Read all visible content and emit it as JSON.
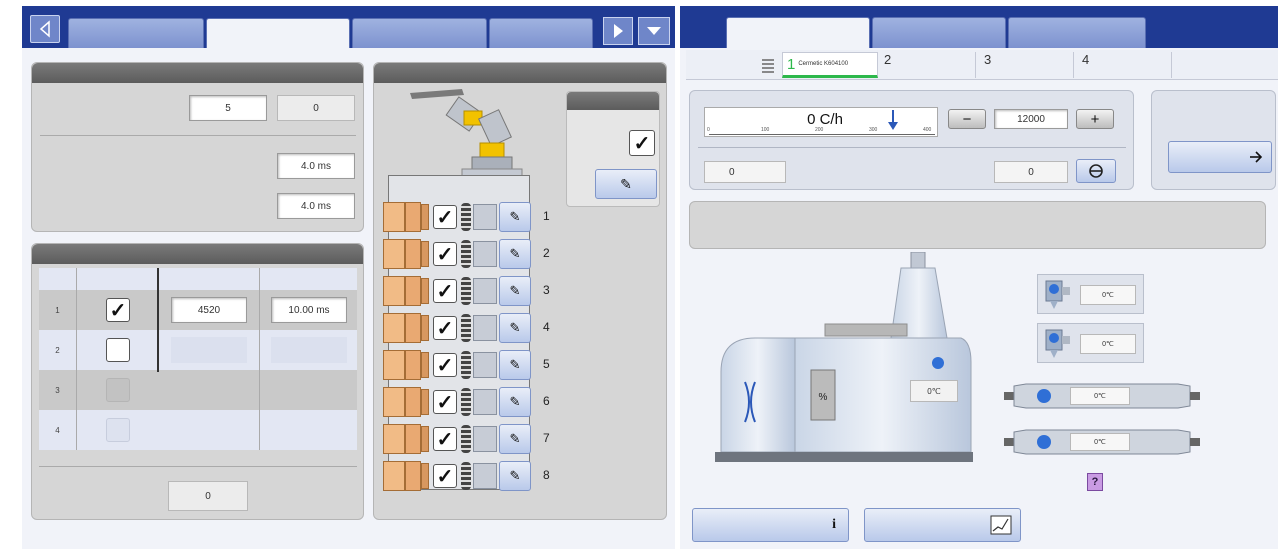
{
  "left_tabs": {
    "nav_prev_icon": "chevron-left",
    "nav_next_icon": "play-right",
    "dropdown_icon": "triangle-down"
  },
  "settings_panel": {
    "value_a": "5",
    "value_b": "0",
    "time_1": "4.0 ms",
    "time_2": "4.0 ms"
  },
  "channel_table": {
    "rows": [
      {
        "num": "1",
        "checked": "✓",
        "value": "4520",
        "time": "10.00 ms"
      },
      {
        "num": "2",
        "checked": "",
        "value": "",
        "time": ""
      },
      {
        "num": "3",
        "checked": "",
        "value": "",
        "time": ""
      },
      {
        "num": "4",
        "checked": "",
        "value": "",
        "time": ""
      }
    ],
    "footer_value": "0"
  },
  "valve_panel": {
    "global_check": "✓",
    "valves": [
      {
        "num": "1",
        "check": "✓"
      },
      {
        "num": "2",
        "check": "✓"
      },
      {
        "num": "3",
        "check": "✓"
      },
      {
        "num": "4",
        "check": "✓"
      },
      {
        "num": "5",
        "check": "✓"
      },
      {
        "num": "6",
        "check": "✓"
      },
      {
        "num": "7",
        "check": "✓"
      },
      {
        "num": "8",
        "check": "✓"
      }
    ],
    "edit_icon": "✎"
  },
  "right_subtabs": [
    {
      "num": "1",
      "label": "Cermetic K604100"
    },
    {
      "num": "2",
      "label": ""
    },
    {
      "num": "3",
      "label": ""
    },
    {
      "num": "4",
      "label": ""
    }
  ],
  "rate_panel": {
    "rate": "0 C/h",
    "scale_ticks": [
      "0",
      "100",
      "200",
      "300",
      "400"
    ],
    "setpoint": "12000",
    "minus": "−",
    "plus": "+",
    "field_left": "0",
    "field_right": "0"
  },
  "machine": {
    "temp_center": "0℃",
    "sensor_top": "0℃",
    "sensor_mid": "0℃",
    "heater_1": "0℃",
    "heater_2": "0℃",
    "help": "?",
    "gauge_label": "%"
  },
  "bottom_buttons": {
    "info_icon": "i"
  }
}
